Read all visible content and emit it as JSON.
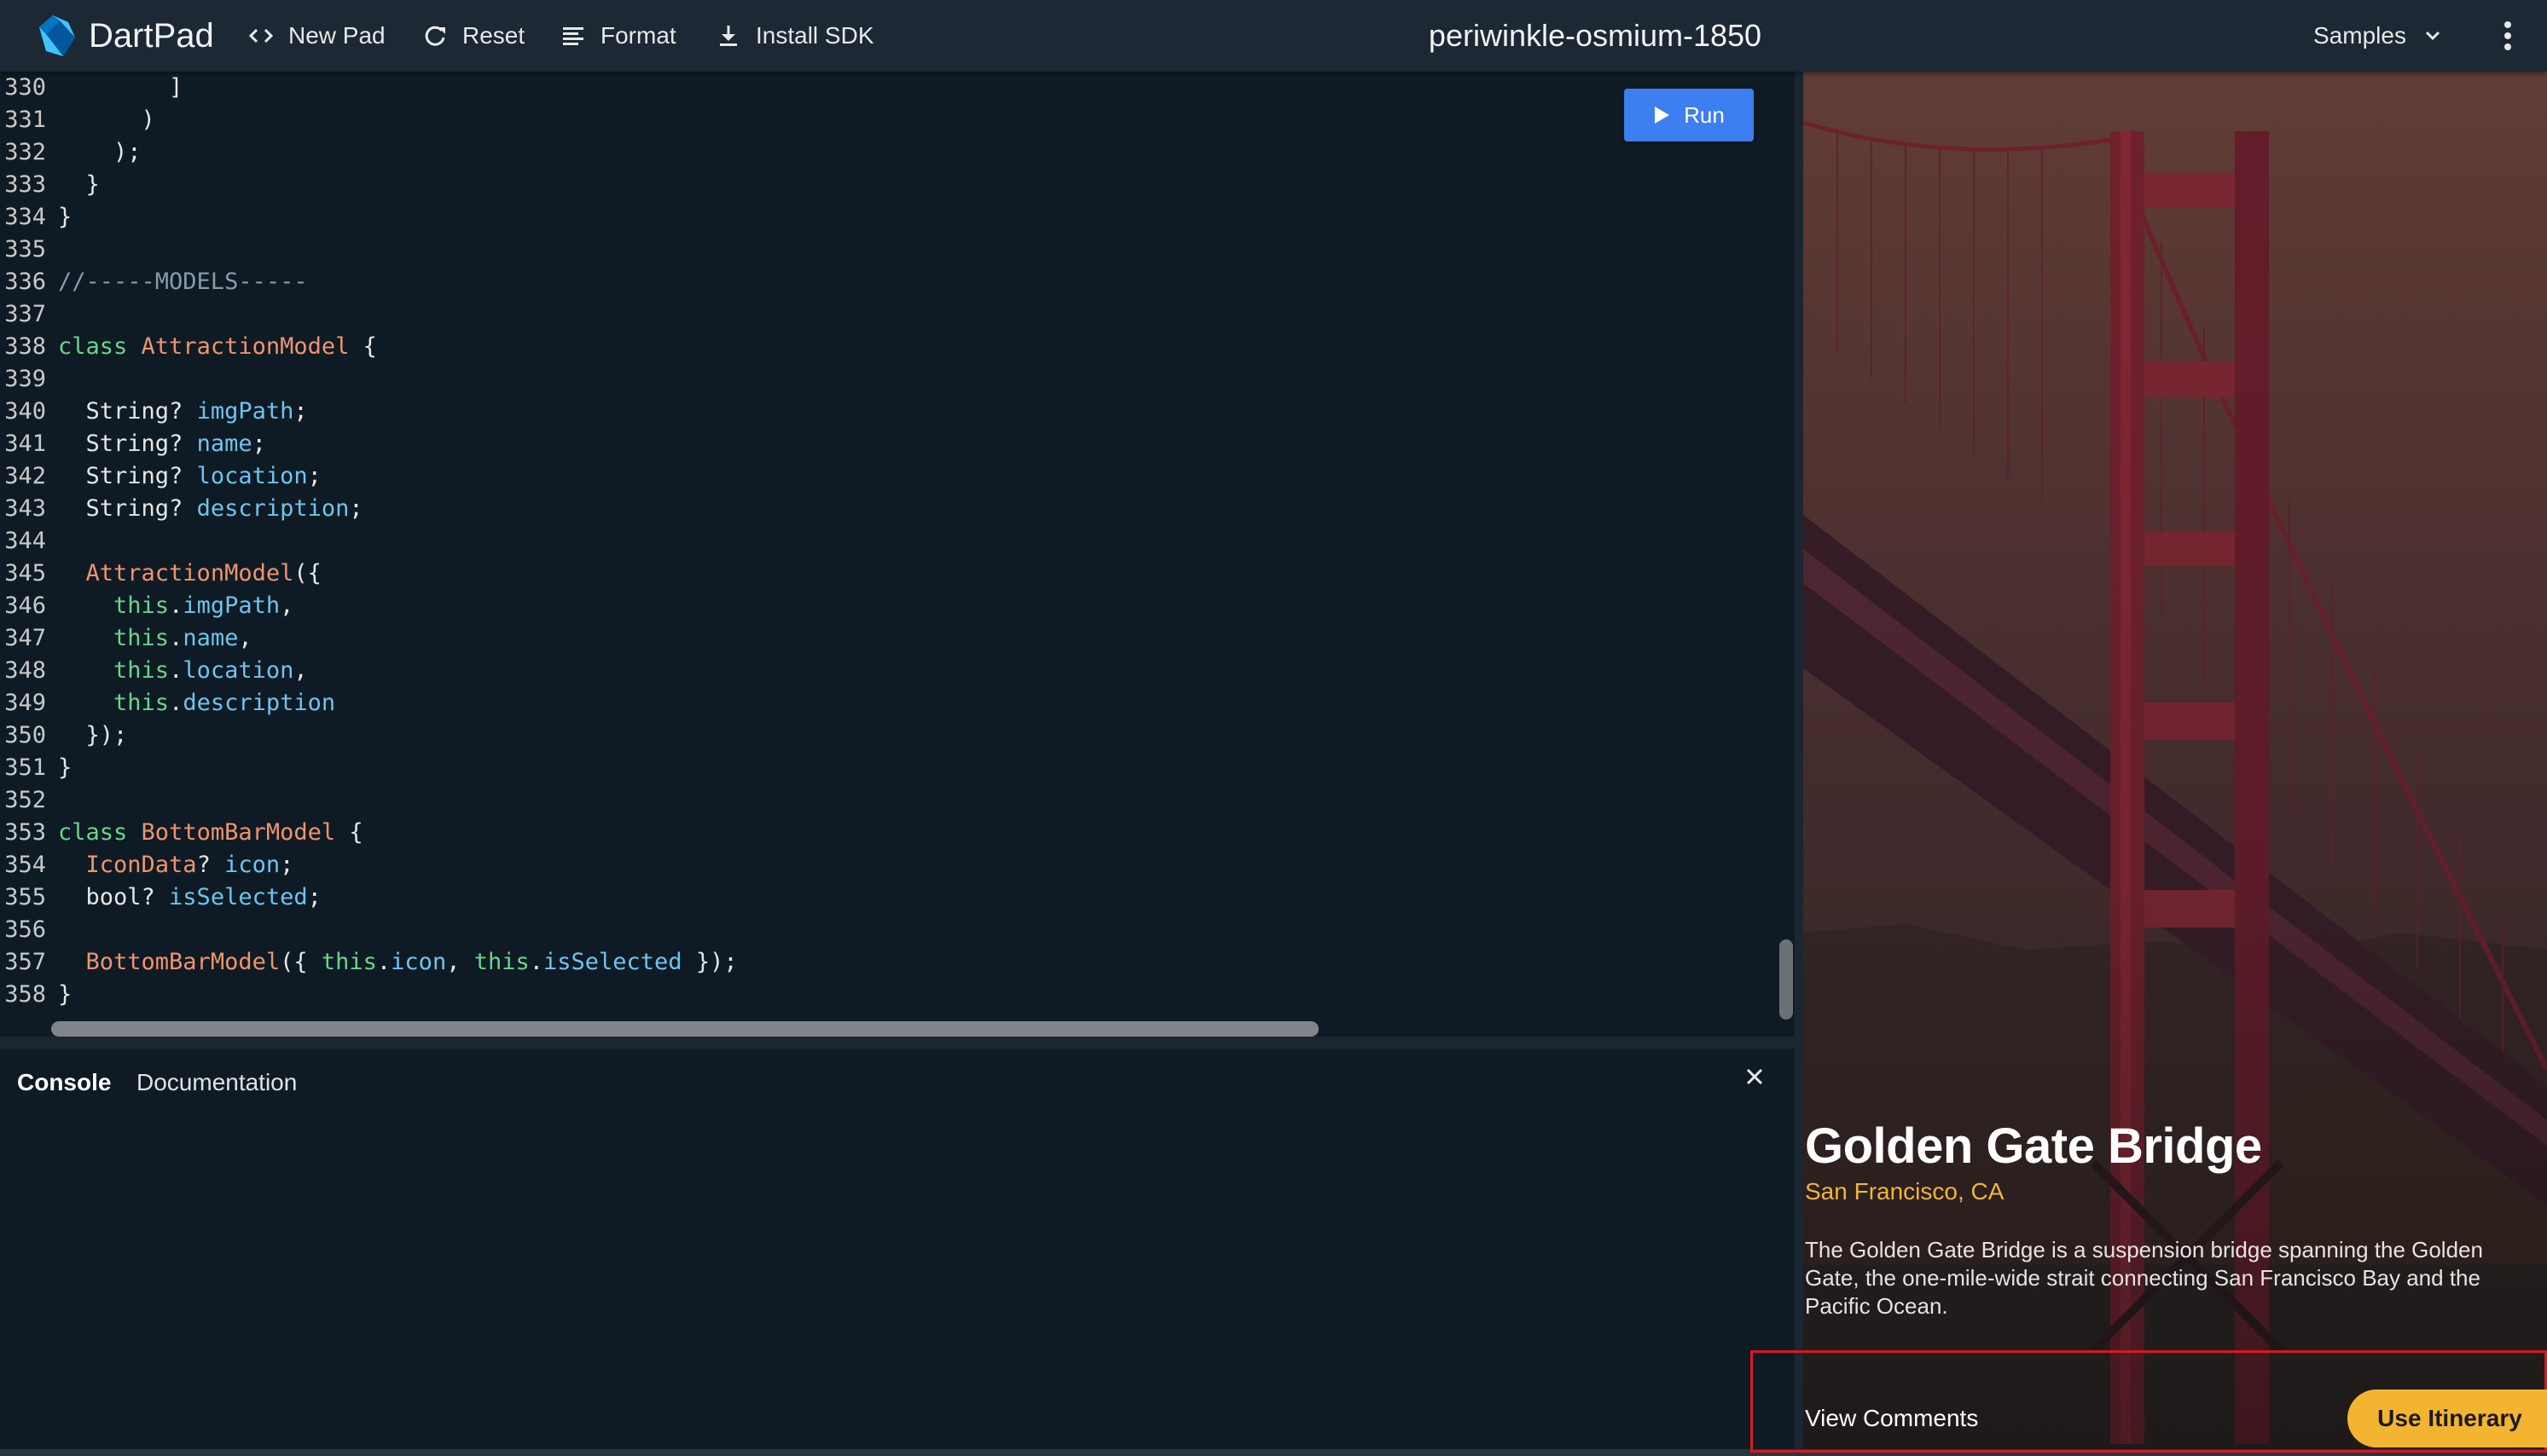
{
  "colors": {
    "accent": "#3d7ef0",
    "highlight": "#f3b531",
    "keyword": "#6bd48a",
    "class_name": "#f0936e",
    "identifier": "#6fc3ef",
    "annotation_box": "#d71920"
  },
  "toolbar": {
    "brand": "DartPad",
    "new_pad": "New Pad",
    "reset": "Reset",
    "format": "Format",
    "install_sdk": "Install SDK",
    "samples": "Samples",
    "icons": {
      "logo": "dart-logo",
      "new_pad": "code-brackets-icon",
      "reset": "refresh-icon",
      "format": "align-left-icon",
      "install_sdk": "download-icon",
      "samples": "chevron-down-icon",
      "more": "more-vertical-icon"
    }
  },
  "pad_title": "periwinkle-osmium-1850",
  "editor": {
    "run_label": "Run",
    "lines": [
      {
        "n": "330",
        "t": [
          [
            "p",
            "        ]"
          ]
        ]
      },
      {
        "n": "331",
        "t": [
          [
            "p",
            "      )"
          ]
        ]
      },
      {
        "n": "332",
        "t": [
          [
            "p",
            "    );"
          ]
        ]
      },
      {
        "n": "333",
        "t": [
          [
            "p",
            "  }"
          ]
        ]
      },
      {
        "n": "334",
        "t": [
          [
            "p",
            "}"
          ]
        ]
      },
      {
        "n": "335",
        "t": []
      },
      {
        "n": "336",
        "t": [
          [
            "c",
            "//-----MODELS-----"
          ]
        ]
      },
      {
        "n": "337",
        "t": []
      },
      {
        "n": "338",
        "t": [
          [
            "k",
            "class"
          ],
          [
            "p",
            " "
          ],
          [
            "cl",
            "AttractionModel"
          ],
          [
            "p",
            " {"
          ]
        ]
      },
      {
        "n": "339",
        "t": []
      },
      {
        "n": "340",
        "t": [
          [
            "p",
            "  String? "
          ],
          [
            "v",
            "imgPath"
          ],
          [
            "p",
            ";"
          ]
        ]
      },
      {
        "n": "341",
        "t": [
          [
            "p",
            "  String? "
          ],
          [
            "v",
            "name"
          ],
          [
            "p",
            ";"
          ]
        ]
      },
      {
        "n": "342",
        "t": [
          [
            "p",
            "  String? "
          ],
          [
            "v",
            "location"
          ],
          [
            "p",
            ";"
          ]
        ]
      },
      {
        "n": "343",
        "t": [
          [
            "p",
            "  String? "
          ],
          [
            "v",
            "description"
          ],
          [
            "p",
            ";"
          ]
        ]
      },
      {
        "n": "344",
        "t": []
      },
      {
        "n": "345",
        "t": [
          [
            "p",
            "  "
          ],
          [
            "cl",
            "AttractionModel"
          ],
          [
            "p",
            "({"
          ]
        ]
      },
      {
        "n": "346",
        "t": [
          [
            "p",
            "    "
          ],
          [
            "k",
            "this"
          ],
          [
            "p",
            "."
          ],
          [
            "v",
            "imgPath"
          ],
          [
            "p",
            ","
          ]
        ]
      },
      {
        "n": "347",
        "t": [
          [
            "p",
            "    "
          ],
          [
            "k",
            "this"
          ],
          [
            "p",
            "."
          ],
          [
            "v",
            "name"
          ],
          [
            "p",
            ","
          ]
        ]
      },
      {
        "n": "348",
        "t": [
          [
            "p",
            "    "
          ],
          [
            "k",
            "this"
          ],
          [
            "p",
            "."
          ],
          [
            "v",
            "location"
          ],
          [
            "p",
            ","
          ]
        ]
      },
      {
        "n": "349",
        "t": [
          [
            "p",
            "    "
          ],
          [
            "k",
            "this"
          ],
          [
            "p",
            "."
          ],
          [
            "v",
            "description"
          ]
        ]
      },
      {
        "n": "350",
        "t": [
          [
            "p",
            "  });"
          ]
        ]
      },
      {
        "n": "351",
        "t": [
          [
            "p",
            "}"
          ]
        ]
      },
      {
        "n": "352",
        "t": []
      },
      {
        "n": "353",
        "t": [
          [
            "k",
            "class"
          ],
          [
            "p",
            " "
          ],
          [
            "cl",
            "BottomBarModel"
          ],
          [
            "p",
            " {"
          ]
        ]
      },
      {
        "n": "354",
        "t": [
          [
            "p",
            "  "
          ],
          [
            "cl",
            "IconData"
          ],
          [
            "p",
            "? "
          ],
          [
            "v",
            "icon"
          ],
          [
            "p",
            ";"
          ]
        ]
      },
      {
        "n": "355",
        "t": [
          [
            "p",
            "  bool? "
          ],
          [
            "v",
            "isSelected"
          ],
          [
            "p",
            ";"
          ]
        ]
      },
      {
        "n": "356",
        "t": []
      },
      {
        "n": "357",
        "t": [
          [
            "p",
            "  "
          ],
          [
            "cl",
            "BottomBarModel"
          ],
          [
            "p",
            "({ "
          ],
          [
            "k",
            "this"
          ],
          [
            "p",
            "."
          ],
          [
            "v",
            "icon"
          ],
          [
            "p",
            ", "
          ],
          [
            "k",
            "this"
          ],
          [
            "p",
            "."
          ],
          [
            "v",
            "isSelected"
          ],
          [
            "p",
            " });"
          ]
        ]
      },
      {
        "n": "358",
        "t": [
          [
            "p",
            "}"
          ]
        ]
      }
    ]
  },
  "console": {
    "tab_console": "Console",
    "tab_docs": "Documentation",
    "close_icon": "close-icon"
  },
  "preview": {
    "image": "golden-gate-bridge-photo",
    "name": "Golden Gate Bridge",
    "location": "San Francisco, CA",
    "description": "The Golden Gate Bridge is a suspension bridge spanning the Golden Gate, the one-mile-wide strait connecting San Francisco Bay and the Pacific Ocean.",
    "view_comments": "View Comments",
    "use_itinerary": "Use Itinerary"
  }
}
